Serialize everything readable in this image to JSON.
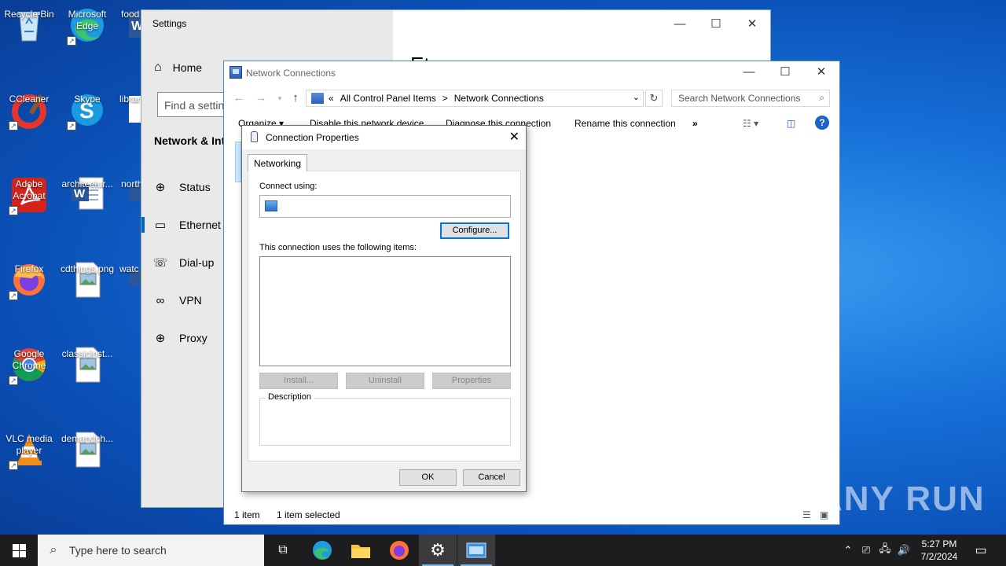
{
  "desktop": {
    "icons": [
      {
        "label": "Recycle Bin",
        "icon": "recycle-bin-icon"
      },
      {
        "label": "Microsoft Edge",
        "icon": "edge-icon"
      },
      {
        "label": "food",
        "icon": "word-doc-icon"
      },
      {
        "label": "CCleaner",
        "icon": "ccleaner-icon"
      },
      {
        "label": "Skype",
        "icon": "skype-icon"
      },
      {
        "label": "librar",
        "icon": "word-doc-icon"
      },
      {
        "label": "Adobe Acrobat",
        "icon": "acrobat-icon"
      },
      {
        "label": "architectur...",
        "icon": "word-doc-icon"
      },
      {
        "label": "north",
        "icon": "word-doc-icon"
      },
      {
        "label": "Firefox",
        "icon": "firefox-icon"
      },
      {
        "label": "cdthings.png",
        "icon": "image-file-icon"
      },
      {
        "label": "watc",
        "icon": "word-doc-icon"
      },
      {
        "label": "Google Chrome",
        "icon": "chrome-icon"
      },
      {
        "label": "classicinst...",
        "icon": "image-file-icon"
      },
      {
        "label": "VLC media player",
        "icon": "vlc-icon"
      },
      {
        "label": "demandch...",
        "icon": "image-file-icon"
      }
    ]
  },
  "settings": {
    "title": "Settings",
    "home": "Home",
    "find_placeholder": "Find a settin",
    "section": "Network & Int",
    "page_title": "Et",
    "nav": [
      {
        "label": "Status",
        "icon": "globe-status-icon"
      },
      {
        "label": "Ethernet",
        "icon": "ethernet-icon"
      },
      {
        "label": "Dial-up",
        "icon": "dialup-icon"
      },
      {
        "label": "VPN",
        "icon": "vpn-icon"
      },
      {
        "label": "Proxy",
        "icon": "proxy-globe-icon"
      }
    ]
  },
  "netconn": {
    "title": "Network Connections",
    "breadcrumb": {
      "prefix": "«",
      "parent": "All Control Panel Items",
      "separator": ">",
      "current": "Network Connections"
    },
    "search_placeholder": "Search Network Connections",
    "commands": {
      "organize": "Organize ▾",
      "disable": "Disable this network device",
      "diagnose": "Diagnose this connection",
      "rename": "Rename this connection",
      "more": "»"
    },
    "status": {
      "items": "1 item",
      "selected": "1 item selected"
    }
  },
  "props": {
    "title": "Connection Properties",
    "tab": "Networking",
    "connect_using": "Connect using:",
    "adapter_value": "",
    "configure": "Configure...",
    "items_label": "This connection uses the following items:",
    "install": "Install...",
    "uninstall": "Uninstall",
    "properties": "Properties",
    "description": "Description",
    "ok": "OK",
    "cancel": "Cancel"
  },
  "taskbar": {
    "search_placeholder": "Type here to search",
    "time": "5:27 PM",
    "date": "7/2/2024"
  },
  "watermark": "ANY RUN"
}
